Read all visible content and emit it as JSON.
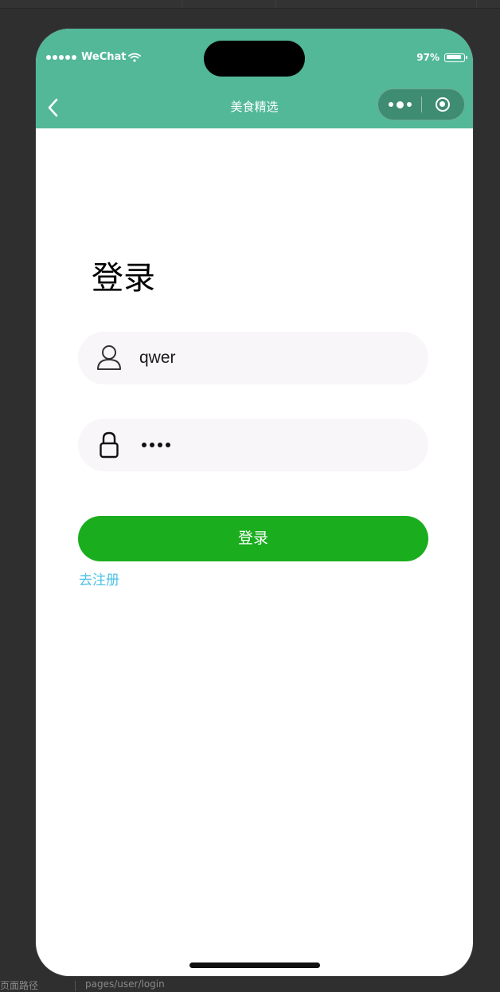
{
  "status_bar": {
    "carrier": "WeChat",
    "battery": "97%"
  },
  "nav": {
    "title": "美食精选"
  },
  "login": {
    "heading": "登录",
    "username_value": "qwer",
    "password_mask": "••••",
    "submit_label": "登录",
    "register_link": "去注册"
  },
  "ide_footer": {
    "path_label": "页面路径",
    "path_value": "pages/user/login"
  },
  "colors": {
    "header_bg": "#52b898",
    "button_bg": "#1aad1e",
    "link": "#4ec2e6",
    "input_bg": "#f8f6f8"
  }
}
